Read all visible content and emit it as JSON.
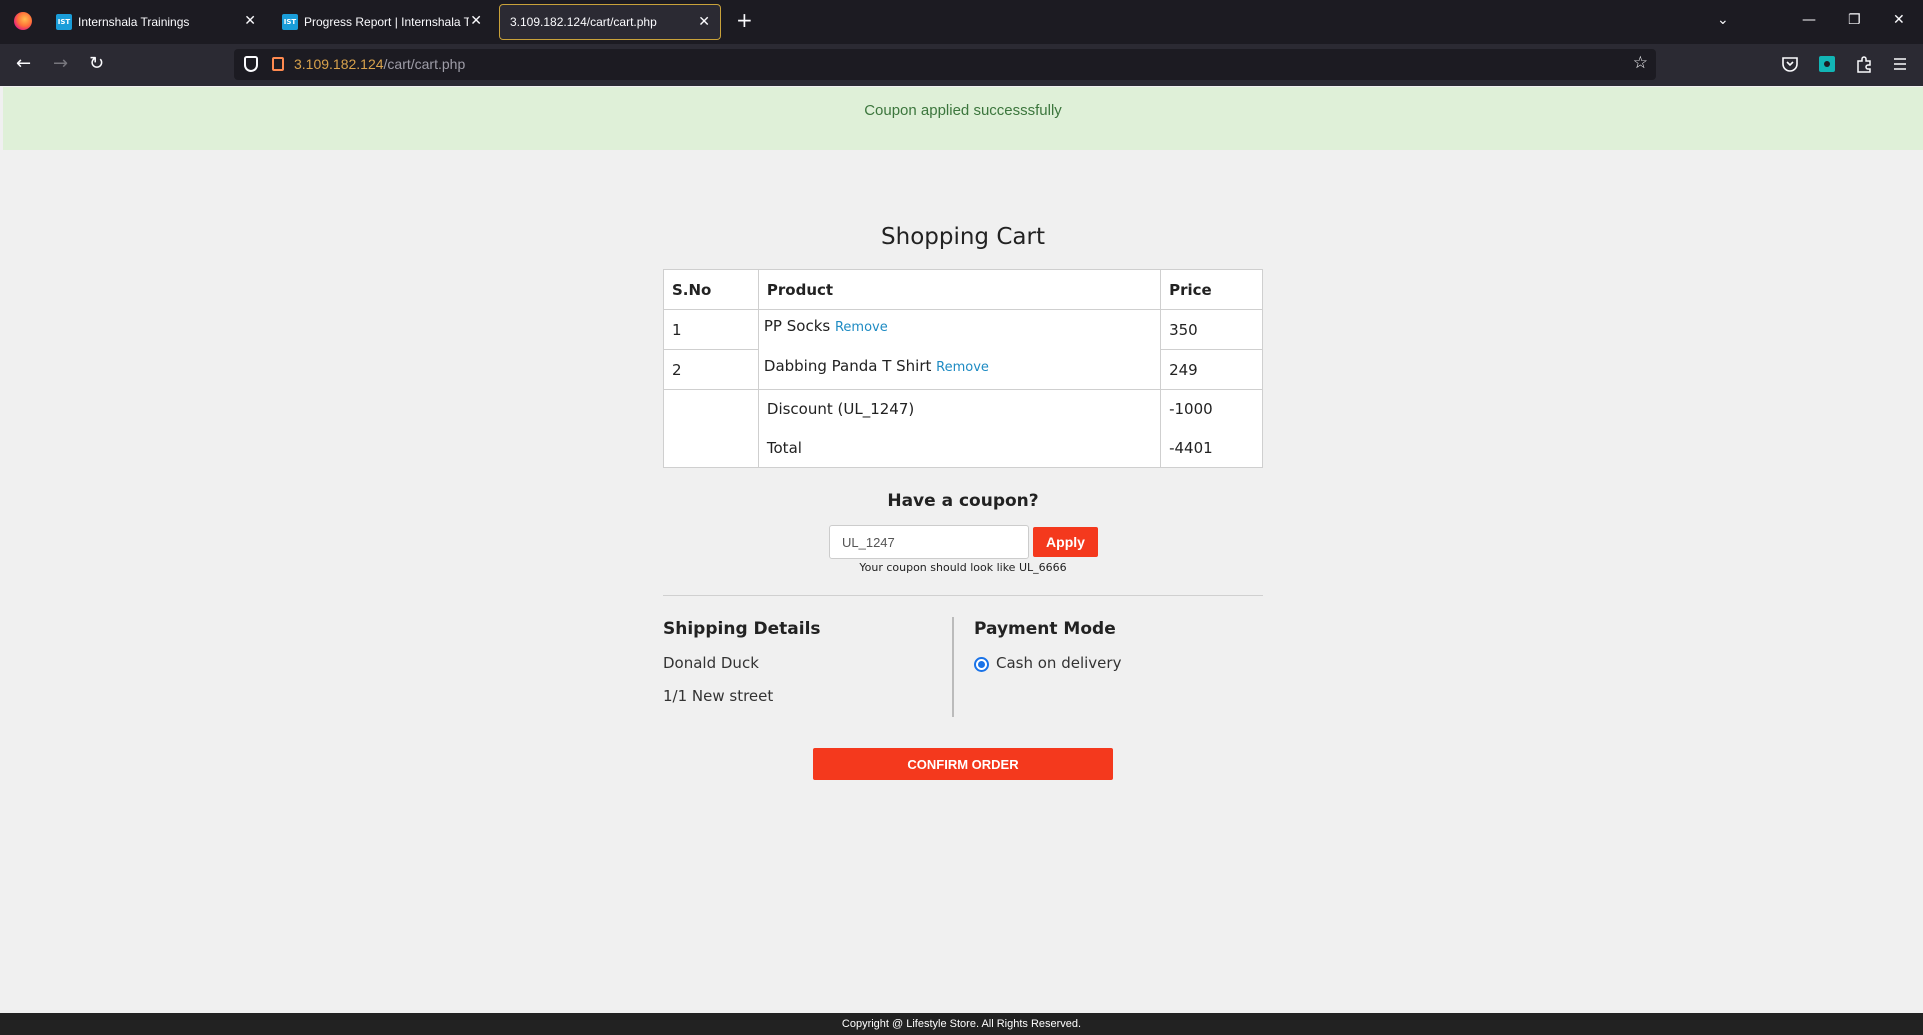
{
  "browser": {
    "tabs": [
      {
        "title": "Internshala Trainings",
        "favicon": "IST"
      },
      {
        "title": "Progress Report | Internshala Tra",
        "favicon": "IST"
      },
      {
        "title": "3.109.182.124/cart/cart.php"
      }
    ],
    "url_host": "3.109.182.124",
    "url_path": "/cart/cart.php",
    "accent_color": "#c9a23a"
  },
  "alert": {
    "message": "Coupon applied successsfully",
    "color": "#3c763d",
    "background": "#dff0d8"
  },
  "cart": {
    "title": "Shopping Cart",
    "headers": [
      "S.No",
      "Product",
      "Price"
    ],
    "items": [
      {
        "sno": "1",
        "product": "PP Socks",
        "remove_label": "Remove",
        "price": "350"
      },
      {
        "sno": "2",
        "product": "Dabbing Panda T Shirt",
        "remove_label": "Remove",
        "price": "249"
      }
    ],
    "discount_label": "Discount (UL_1247)",
    "discount_value": "-1000",
    "total_label": "Total",
    "total_value": "-4401"
  },
  "coupon": {
    "title": "Have a coupon?",
    "value": "UL_1247",
    "apply_label": "Apply",
    "hint": "Your coupon should look like UL_6666"
  },
  "shipping": {
    "title": "Shipping Details",
    "name": "Donald Duck",
    "address": "1/1 New street"
  },
  "payment": {
    "title": "Payment Mode",
    "option": "Cash on delivery",
    "selected": true
  },
  "confirm_label": "CONFIRM ORDER",
  "footer": "Copyright @ Lifestyle Store. All Rights Reserved.",
  "colors": {
    "brand_red": "#f4391d",
    "link_blue": "#1e8bc3"
  }
}
